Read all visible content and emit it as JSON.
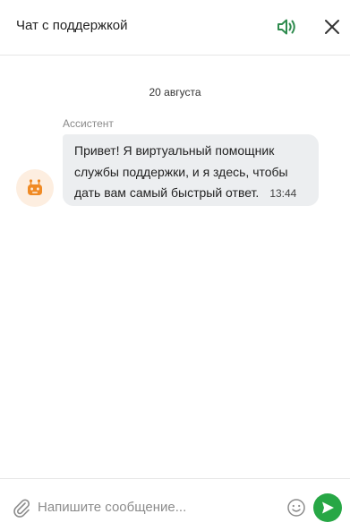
{
  "header": {
    "title": "Чат с поддержкой"
  },
  "chat": {
    "date_separator": "20 августа",
    "messages": [
      {
        "sender": "Ассистент",
        "text": "Привет! Я виртуальный помощник службы поддержки, и я здесь, чтобы дать вам самый быстрый ответ.",
        "time": "13:44"
      }
    ]
  },
  "composer": {
    "placeholder": "Напишите сообщение..."
  },
  "icons": {
    "speaker": "speaker-icon",
    "close": "close-icon",
    "avatar": "robot-icon",
    "attach": "paperclip-icon",
    "emoji": "smiley-icon",
    "send": "send-icon"
  },
  "colors": {
    "accent": "#27a745",
    "speaker": "#2e8b4e",
    "avatar_bg": "#fdeee0",
    "avatar_icon": "#f08a24",
    "bubble_bg": "#eceef0"
  }
}
